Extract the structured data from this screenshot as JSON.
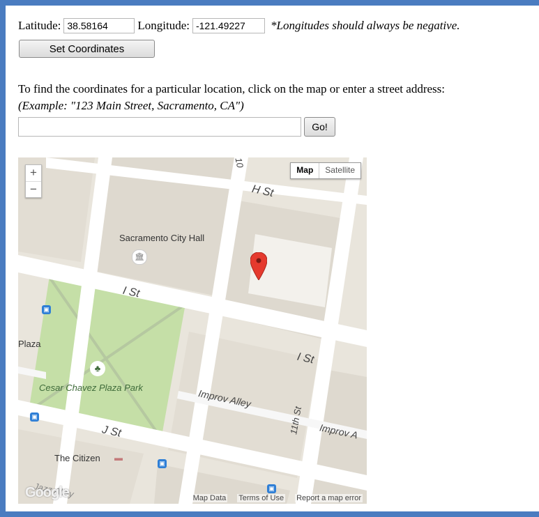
{
  "form": {
    "latitude_label": "Latitude:",
    "latitude_value": "38.58164",
    "longitude_label": "Longitude:",
    "longitude_value": "-121.49227",
    "note": "*Longitudes should always be negative.",
    "set_button": "Set Coordinates",
    "instructions": "To find the coordinates for a particular location, click on the map or enter a street address:",
    "example": "(Example: \"123 Main Street, Sacramento, CA\")",
    "address_value": "",
    "go_button": "Go!"
  },
  "map": {
    "zoom_in": "+",
    "zoom_out": "−",
    "type_map": "Map",
    "type_satellite": "Satellite",
    "streets": {
      "h_st": "H St",
      "i_st_left": "I St",
      "i_st_right": "I St",
      "j_st": "J St",
      "improv_alley": "Improv Alley",
      "improv_alley_right": "Improv A",
      "eleventh_st": "11th St",
      "tenth_st": "10",
      "jazz_alley": "Jazz Alley"
    },
    "pois": {
      "city_hall": "Sacramento City Hall",
      "park": "Cesar Chavez Plaza Park",
      "plaza": "Plaza",
      "citizen": "The Citizen"
    },
    "footer": {
      "map_data": "Map Data",
      "terms": "Terms of Use",
      "report": "Report a map error"
    },
    "logo": "Google",
    "colors": {
      "block": "#e9e5dc",
      "road": "#ffffff",
      "park": "#c5dfa7",
      "building": "#ded9cf",
      "marker": "#e53a2e"
    },
    "icons": [
      "plus-icon",
      "minus-icon",
      "map-marker-icon",
      "bus-icon",
      "tree-icon",
      "museum-icon",
      "hotel-icon"
    ]
  }
}
